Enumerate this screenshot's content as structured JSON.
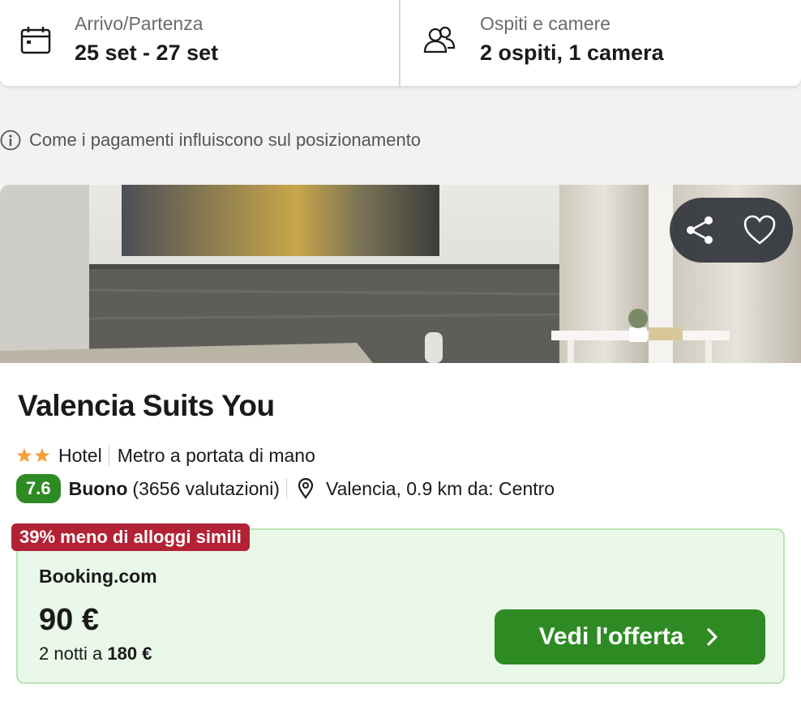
{
  "search": {
    "dates_label": "Arrivo/Partenza",
    "dates_value": "25 set - 27 set",
    "guests_label": "Ospiti e camere",
    "guests_value": "2 ospiti, 1 camera"
  },
  "info": {
    "text": "Come i pagamenti influiscono sul posizionamento",
    "icon": "info-icon"
  },
  "hotel": {
    "name": "Valencia Suits You",
    "stars": 2,
    "type": "Hotel",
    "feature": "Metro a portata di mano",
    "score": "7.6",
    "rating_word": "Buono",
    "reviews": "(3656 valutazioni)",
    "location": "Valencia, 0.9 km da: Centro"
  },
  "deal": {
    "badge": "39% meno di alloggi simili",
    "provider": "Booking.com",
    "price": "90 €",
    "nights_prefix": "2 notti a",
    "nights_total": "180 €",
    "cta_label": "Vedi l'offerta"
  },
  "colors": {
    "accent_green": "#2e8b23",
    "badge_red": "#b22234",
    "deal_bg": "#eaf8ea",
    "star_orange": "#f5a03a"
  },
  "icons": [
    "calendar-icon",
    "guests-icon",
    "info-icon",
    "share-icon",
    "heart-icon",
    "star-icon",
    "location-pin-icon",
    "chevron-right-icon"
  ]
}
